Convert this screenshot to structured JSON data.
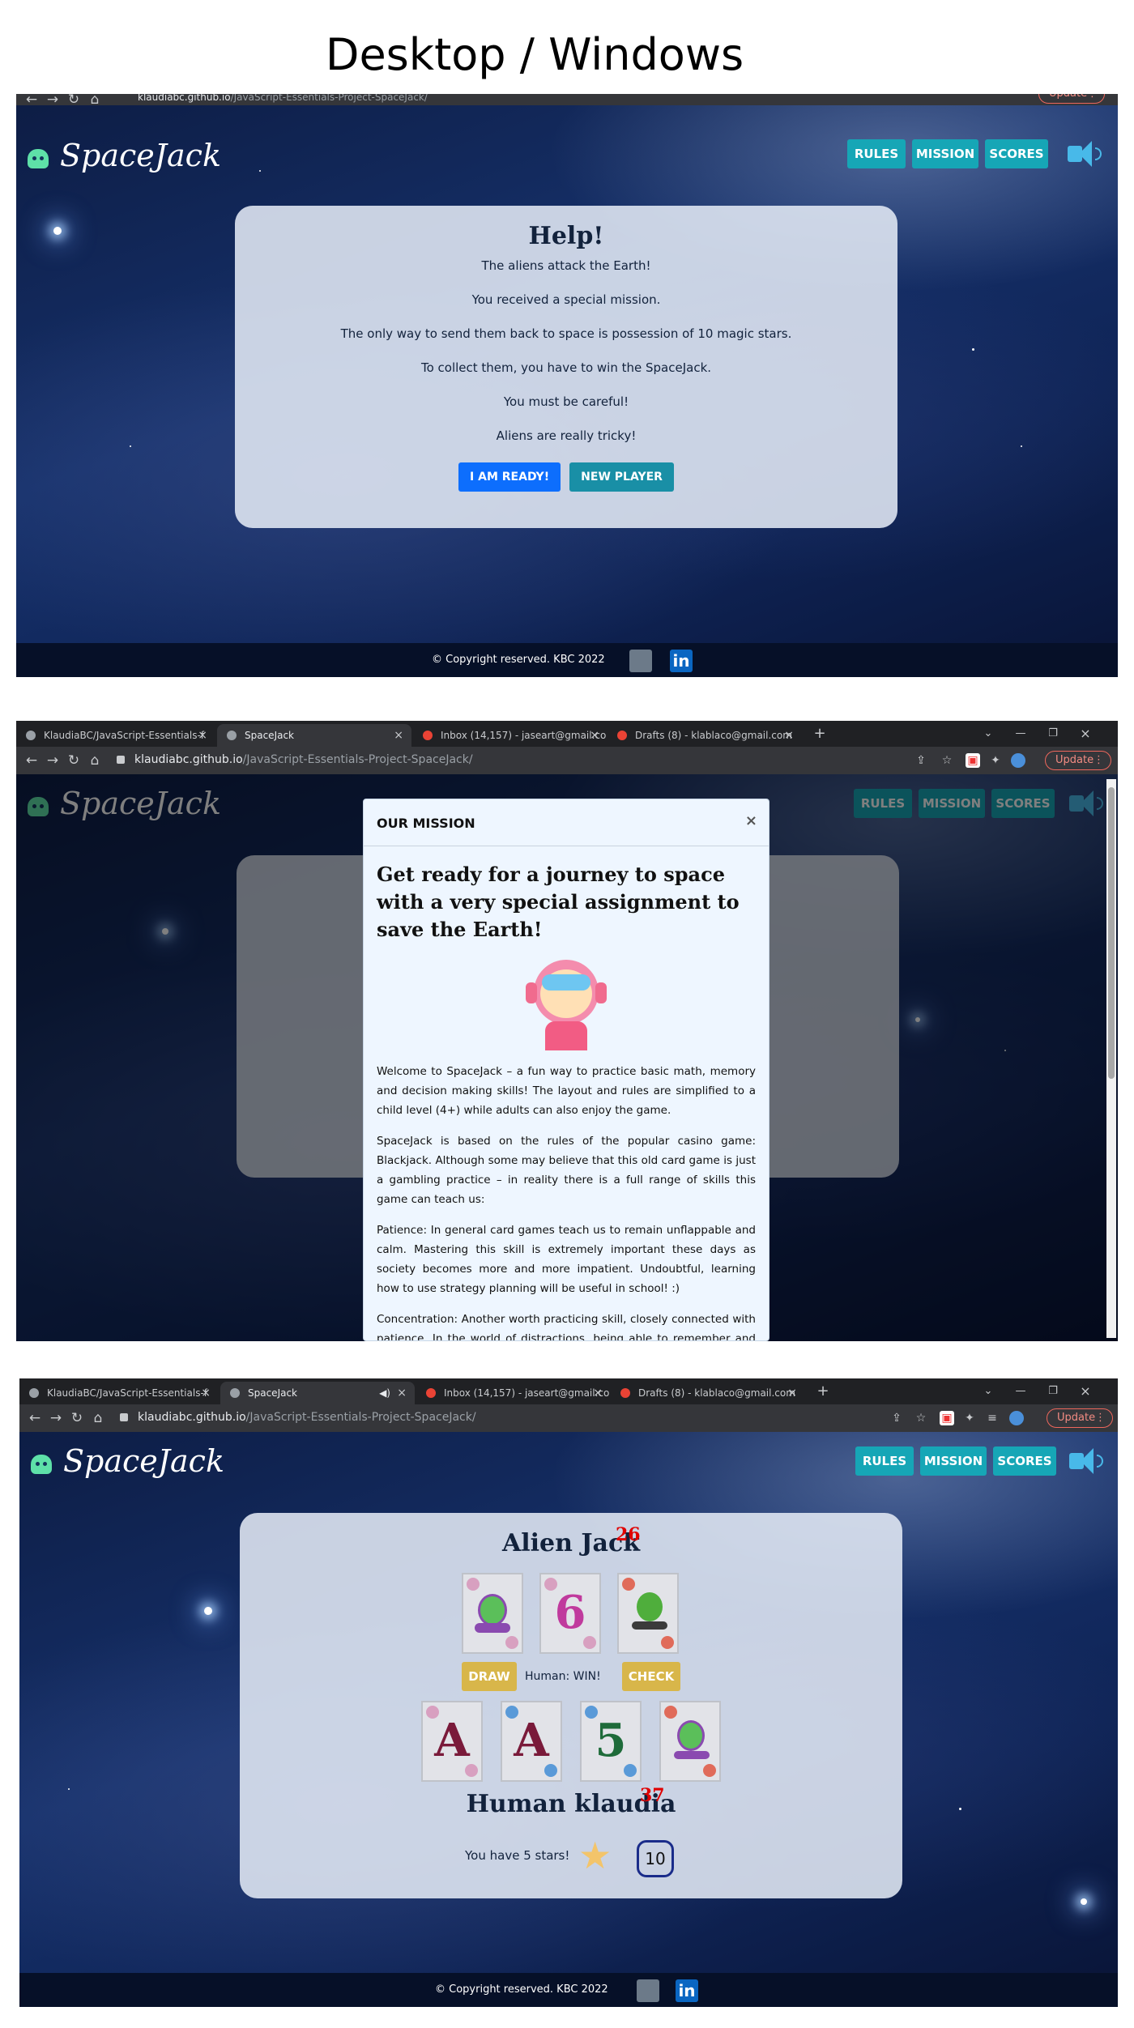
{
  "heading": "Desktop / Windows",
  "browser": {
    "url_host": "klaudiabc.github.io",
    "url_path": "/JavaScript-Essentials-Project-SpaceJack/",
    "update_label": "Update",
    "tabs": [
      {
        "label": "KlaudiaBC/JavaScript-Essentials-f"
      },
      {
        "label": "SpaceJack"
      },
      {
        "label": "Inbox (14,157) - jaseart@gmail.co"
      },
      {
        "label": "Drafts (8) - klablaco@gmail.com"
      }
    ],
    "new_tab": "+",
    "close_glyph": "×"
  },
  "site": {
    "logo": "SpaceJack",
    "nav": {
      "rules": "RULES",
      "mission": "MISSION",
      "scores": "SCORES"
    },
    "footer": "© Copyright reserved. KBC 2022",
    "linkedin_glyph": "in"
  },
  "help": {
    "title": "Help!",
    "lines": [
      "The aliens attack the Earth!",
      "You received a special mission.",
      "The only way to send them back to space is possession of 10 magic stars.",
      "To collect them, you have to win the SpaceJack.",
      "You must be careful!",
      "Aliens are really tricky!"
    ],
    "ready_label": "I AM READY!",
    "new_player_label": "NEW PLAYER"
  },
  "mission": {
    "header": "OUR MISSION",
    "close": "×",
    "title": "Get ready for a journey to space with a very special assignment to save the Earth!",
    "paragraphs": [
      "Welcome to SpaceJack – a fun way to practice basic math, memory and decision making skills! The layout and rules are simplified to a child level (4+) while adults can also enjoy the game.",
      "SpaceJack is based on the rules of the popular casino game: Blackjack. Although some may believe that this old card game is just a gambling practice – in reality there is a full range of skills this game can teach us:",
      "Patience: In general card games teach us to remain unflappable and calm. Mastering this skill is extremely important these days as society becomes more and more impatient. Undoubtful, learning how to use strategy planning will be useful in school! :)",
      "Concentration: Another worth practicing skill, closely connected with patience. In the world of distractions, being able to remember and recall information is crucial. This is why the Player has to remember the value of the cards and correctly sum them in order to make a decision about the next step, which leads"
    ]
  },
  "game": {
    "alien_name": "Alien Jack",
    "alien_score": "26",
    "alien_cards": [
      {
        "kind": "alien-character",
        "text": ""
      },
      {
        "kind": "number",
        "text": "6"
      },
      {
        "kind": "alien-character",
        "text": ""
      }
    ],
    "draw_label": "DRAW",
    "result": "Human: WIN!",
    "check_label": "CHECK",
    "human_cards": [
      {
        "kind": "letter",
        "text": "A"
      },
      {
        "kind": "letter",
        "text": "A"
      },
      {
        "kind": "number",
        "text": "5"
      },
      {
        "kind": "alien-character",
        "text": ""
      }
    ],
    "human_name": "Human klaudia",
    "human_score": "37",
    "stars_text": "You have 5 stars!",
    "target": "10"
  },
  "colors": {
    "nav_button": "#16a6b6",
    "ready_button": "#0d6efd",
    "new_player_button": "#198fa6",
    "game_button": "#d8b64a",
    "score": "#e00000",
    "six_card": "#c03a9d",
    "five_card": "#1e6b3a",
    "a_card": "#7a1a3a"
  }
}
